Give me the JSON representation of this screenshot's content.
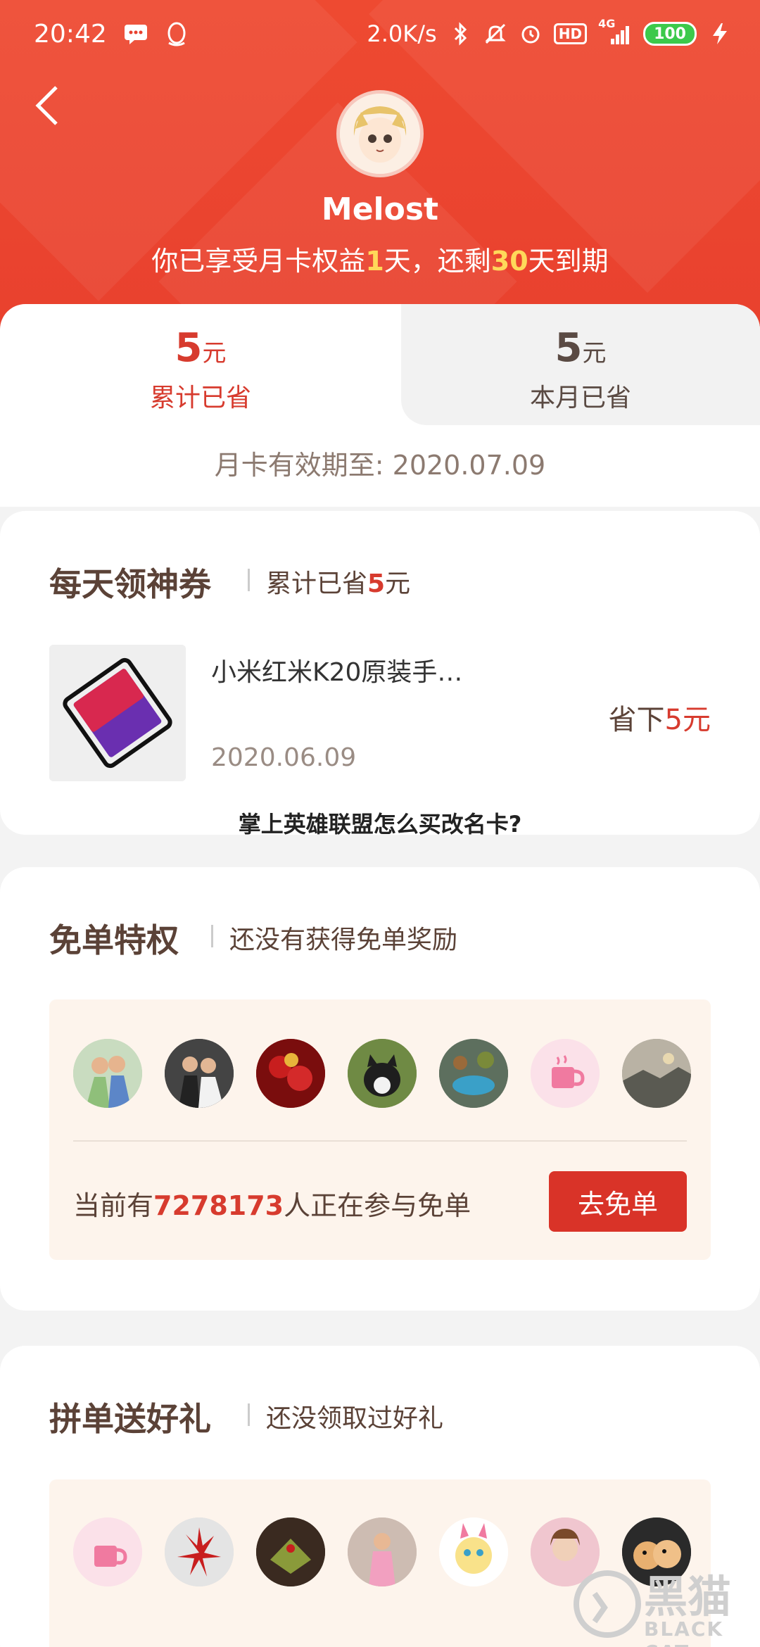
{
  "status_bar": {
    "time": "20:42",
    "speed": "2.0K/s",
    "network": "4G",
    "hd": "HD",
    "battery": "100"
  },
  "header": {
    "username": "Melost",
    "benefit_prefix": "你已享受月卡权益",
    "benefit_days_used": "1",
    "benefit_mid": "天，还剩",
    "benefit_days_left": "30",
    "benefit_suffix": "天到期"
  },
  "savings": {
    "total_amount": "5",
    "total_unit": "元",
    "total_label": "累计已省",
    "month_amount": "5",
    "month_unit": "元",
    "month_label": "本月已省",
    "expiry": "月卡有效期至: 2020.07.09"
  },
  "daily_coupon": {
    "title": "每天领神券",
    "sub_prefix": "累计已省",
    "sub_amount": "5",
    "sub_unit": "元",
    "product_name": "小米红米K20原装手…",
    "product_date": "2020.06.09",
    "save_prefix": "省下",
    "save_amount": "5",
    "save_unit": "元"
  },
  "overlay_caption": "掌上英雄联盟怎么买改名卡?",
  "free_order": {
    "title": "免单特权",
    "subtitle": "还没有获得免单奖励",
    "count_prefix": "当前有",
    "count": "7278173",
    "count_suffix": "人正在参与免单",
    "button": "去免单"
  },
  "group_gift": {
    "title": "拼单送好礼",
    "subtitle": "还没领取过好礼"
  },
  "watermark": {
    "cn": "黑猫",
    "en": "BLACK CAT"
  },
  "colors": {
    "header_red": "#ee4a31",
    "accent_red": "#d73b2e",
    "highlight_yellow": "#ffd85a",
    "panel_bg": "#fdf4ec"
  }
}
